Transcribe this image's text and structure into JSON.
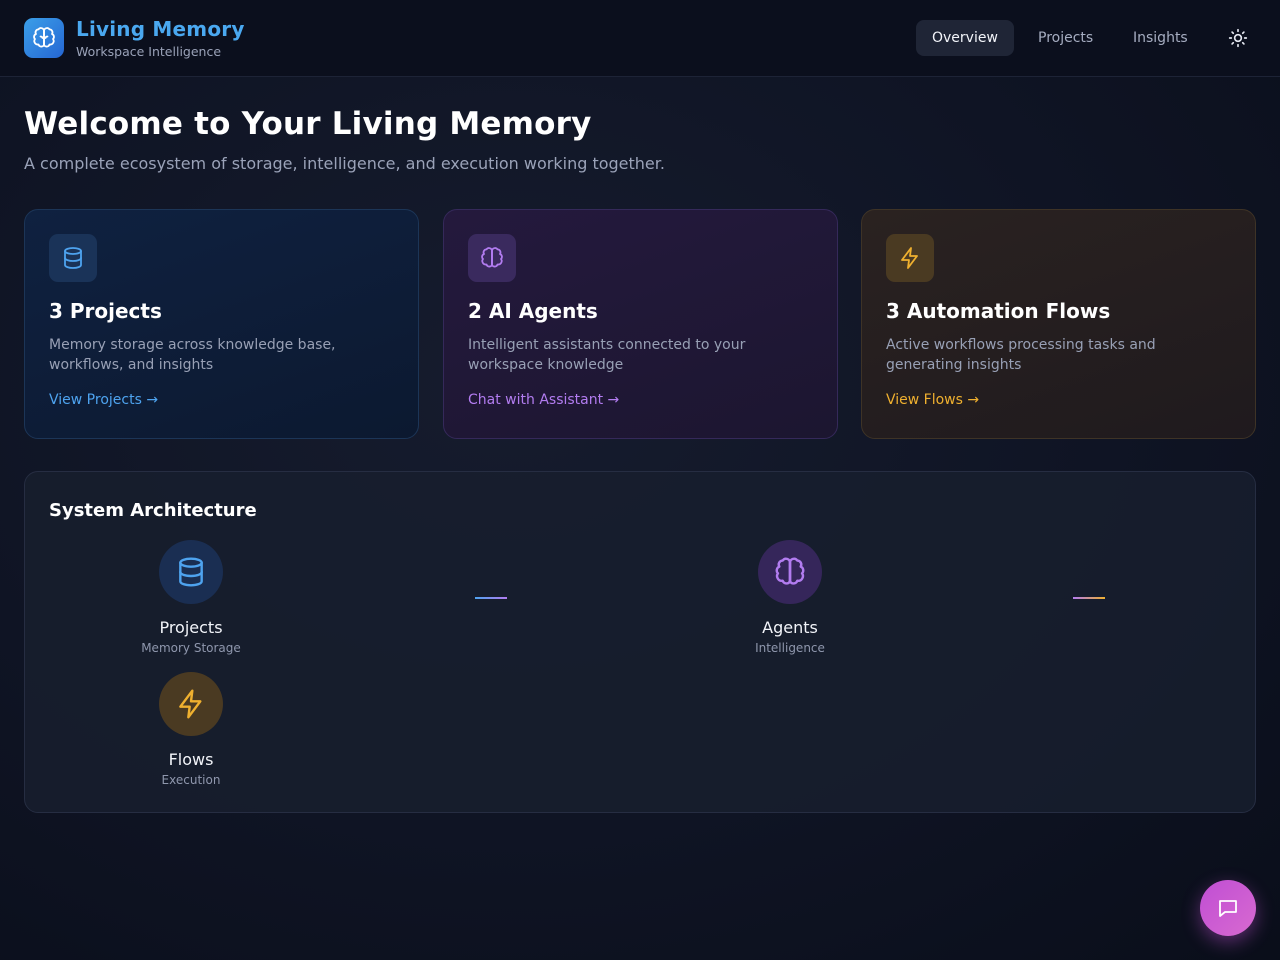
{
  "header": {
    "brand_title": "Living Memory",
    "brand_subtitle": "Workspace Intelligence",
    "logo_icon": "brain-icon",
    "nav": [
      {
        "label": "Overview",
        "active": true
      },
      {
        "label": "Projects",
        "active": false
      },
      {
        "label": "Insights",
        "active": false
      }
    ],
    "theme_icon": "sun-icon"
  },
  "hero": {
    "title": "Welcome to Your Living Memory",
    "subtitle": "A complete ecosystem of storage, intelligence, and execution working together."
  },
  "cards": [
    {
      "icon": "database-icon",
      "title": "3 Projects",
      "description": "Memory storage across knowledge base, workflows, and insights",
      "link": "View Projects →",
      "accent": "#4ea3ef"
    },
    {
      "icon": "brain-icon",
      "title": "2 AI Agents",
      "description": "Intelligent assistants connected to your workspace knowledge",
      "link": "Chat with Assistant →",
      "accent": "#b27cf0"
    },
    {
      "icon": "lightning-icon",
      "title": "3 Automation Flows",
      "description": "Active workflows processing tasks and generating insights",
      "link": "View Flows →",
      "accent": "#efb02f"
    }
  ],
  "architecture": {
    "title": "System Architecture",
    "nodes": [
      {
        "icon": "database-icon",
        "name": "Projects",
        "subtitle": "Memory Storage"
      },
      {
        "icon": "brain-icon",
        "name": "Agents",
        "subtitle": "Intelligence"
      },
      {
        "icon": "lightning-icon",
        "name": "Flows",
        "subtitle": "Execution"
      }
    ]
  },
  "chat_fab_icon": "chat-bubble-icon",
  "colors": {
    "blue": "#4ea3ef",
    "purple": "#b27cf0",
    "amber": "#efb02f"
  }
}
